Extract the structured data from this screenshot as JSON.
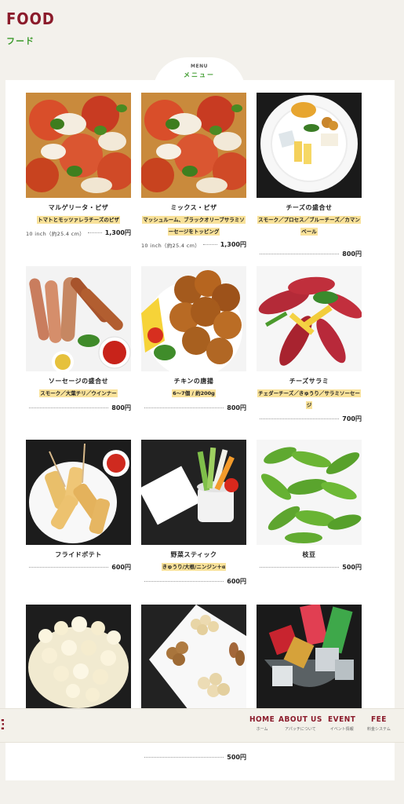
{
  "page": {
    "title_en": "FOOD",
    "title_jp": "フード"
  },
  "menu_tab": {
    "en": "MENU",
    "jp": "メニュー"
  },
  "items": [
    {
      "name": "マルゲリータ・ピザ",
      "desc": "トマトとモッツァレラチーズのピザ",
      "size": "10 inch（約25.4 cm）",
      "price": "1,300円",
      "photo": "pizza"
    },
    {
      "name": "ミックス・ピザ",
      "desc": "マッシュルーム、ブラックオリーブサラミソーセージをトッピング",
      "size": "10 inch（約25.4 cm）",
      "price": "1,300円",
      "photo": "pizza"
    },
    {
      "name": "チーズの盛合せ",
      "desc": "スモーク／プロセス／ブルーチーズ／カマンベール",
      "size": "",
      "price": "800円",
      "photo": "cheese"
    },
    {
      "name": "ソーセージの盛合せ",
      "desc": "スモーク／大葉チリ／ウインナー",
      "size": "",
      "price": "800円",
      "photo": "sausage"
    },
    {
      "name": "チキンの唐揚",
      "desc": "6～7個 / 約200g",
      "size": "",
      "price": "800円",
      "photo": "chicken"
    },
    {
      "name": "チーズサラミ",
      "desc": "チェダーチーズ／きゅうり／サラミソーセージ",
      "size": "",
      "price": "700円",
      "photo": "salami"
    },
    {
      "name": "フライドポテト",
      "desc": "",
      "size": "",
      "price": "600円",
      "photo": "fries"
    },
    {
      "name": "野菜スティック",
      "desc": "きゅうり/大根/ニンジン＋α",
      "size": "",
      "price": "600円",
      "photo": "veg"
    },
    {
      "name": "枝豆",
      "desc": "",
      "size": "",
      "price": "500円",
      "photo": "edamame"
    },
    {
      "name": "",
      "desc": "",
      "size": "",
      "price": "",
      "photo": "popcorn"
    },
    {
      "name": "",
      "desc": "",
      "size": "",
      "price": "500円",
      "photo": "nuts"
    },
    {
      "name": "",
      "desc": "",
      "size": "",
      "price": "",
      "photo": "candy"
    }
  ],
  "nav": [
    {
      "en": "HOME",
      "jp": "ホーム"
    },
    {
      "en": "ABOUT US",
      "jp": "アパッチについて"
    },
    {
      "en": "EVENT",
      "jp": "イベント情報"
    },
    {
      "en": "FEE",
      "jp": "料金システム"
    }
  ],
  "colors": {
    "accent": "#8b1b2b",
    "green": "#3c9a2c",
    "highlight": "#f9e29a"
  }
}
